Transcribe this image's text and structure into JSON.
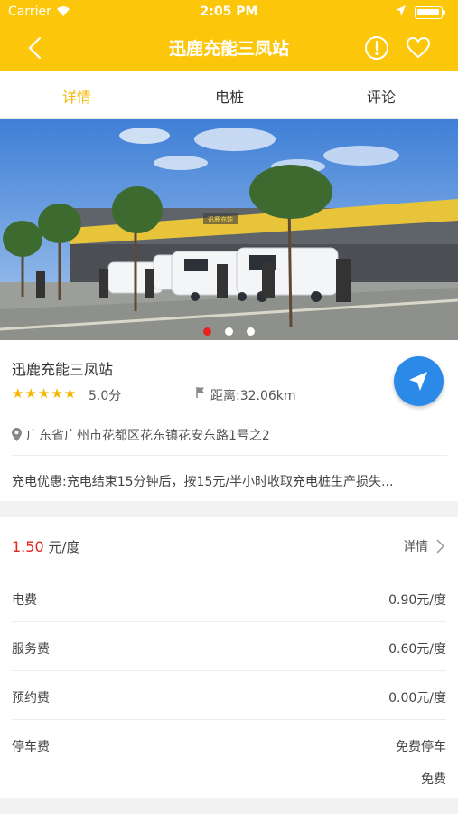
{
  "status_bar": {
    "carrier": "Carrier",
    "time": "2:05 PM"
  },
  "header": {
    "title": "迅鹿充能三凤站"
  },
  "tabs": [
    {
      "label": "详情",
      "active": true
    },
    {
      "label": "电桩",
      "active": false
    },
    {
      "label": "评论",
      "active": false
    }
  ],
  "banner": {
    "sign_text": "迅鹿充能",
    "slide_count": 3,
    "active_slide": 1
  },
  "station": {
    "name": "迅鹿充能三凤站",
    "rating": "5.0分",
    "stars": 5,
    "distance": "距离:32.06km",
    "address": "广东省广州市花都区花东镇花安东路1号之2",
    "promo": "充电优惠:充电结束15分钟后，按15元/半小时收取充电桩生产损失..."
  },
  "pricing": {
    "price": "1.50",
    "unit": " 元/度",
    "detail_label": "详情",
    "fees": [
      {
        "label": "电费",
        "value": "0.90元/度"
      },
      {
        "label": "服务费",
        "value": "0.60元/度"
      },
      {
        "label": "预约费",
        "value": "0.00元/度"
      },
      {
        "label": "停车费",
        "value": "免费停车",
        "value2": "免费"
      }
    ]
  },
  "colors": {
    "accent": "#fcc70a",
    "active_tab": "#f5b800",
    "price": "#e8231f",
    "fab": "#2b8ae8"
  },
  "icons": [
    "wifi-icon",
    "location-arrow-icon",
    "battery-icon",
    "back-icon",
    "info-icon",
    "heart-icon",
    "star-icon",
    "flag-icon",
    "navigate-icon",
    "map-pin-icon",
    "chevron-right-icon"
  ]
}
